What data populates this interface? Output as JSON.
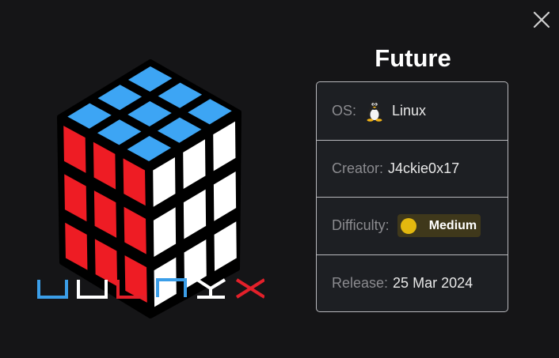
{
  "machine": {
    "name": "Future"
  },
  "brand": {
    "wordmark": "VULNYX",
    "letter_colors": [
      "#3b9ee8",
      "#ffffff",
      "#e3202a",
      "#3b9ee8",
      "#ffffff",
      "#e3202a"
    ]
  },
  "info": {
    "os_label": "OS:",
    "os_value": "Linux",
    "os_icon": "linux-tux-icon",
    "creator_label": "Creator:",
    "creator_value": "J4ckie0x17",
    "difficulty_label": "Difficulty:",
    "difficulty_value": "Medium",
    "difficulty_color": "#e3b80f",
    "release_label": "Release:",
    "release_value": "25 Mar 2024"
  },
  "controls": {
    "close_icon": "close-icon"
  },
  "colors": {
    "background": "#151517",
    "cube_blue": "#3da5f4",
    "cube_red": "#ee1c24",
    "cube_white": "#ffffff"
  }
}
